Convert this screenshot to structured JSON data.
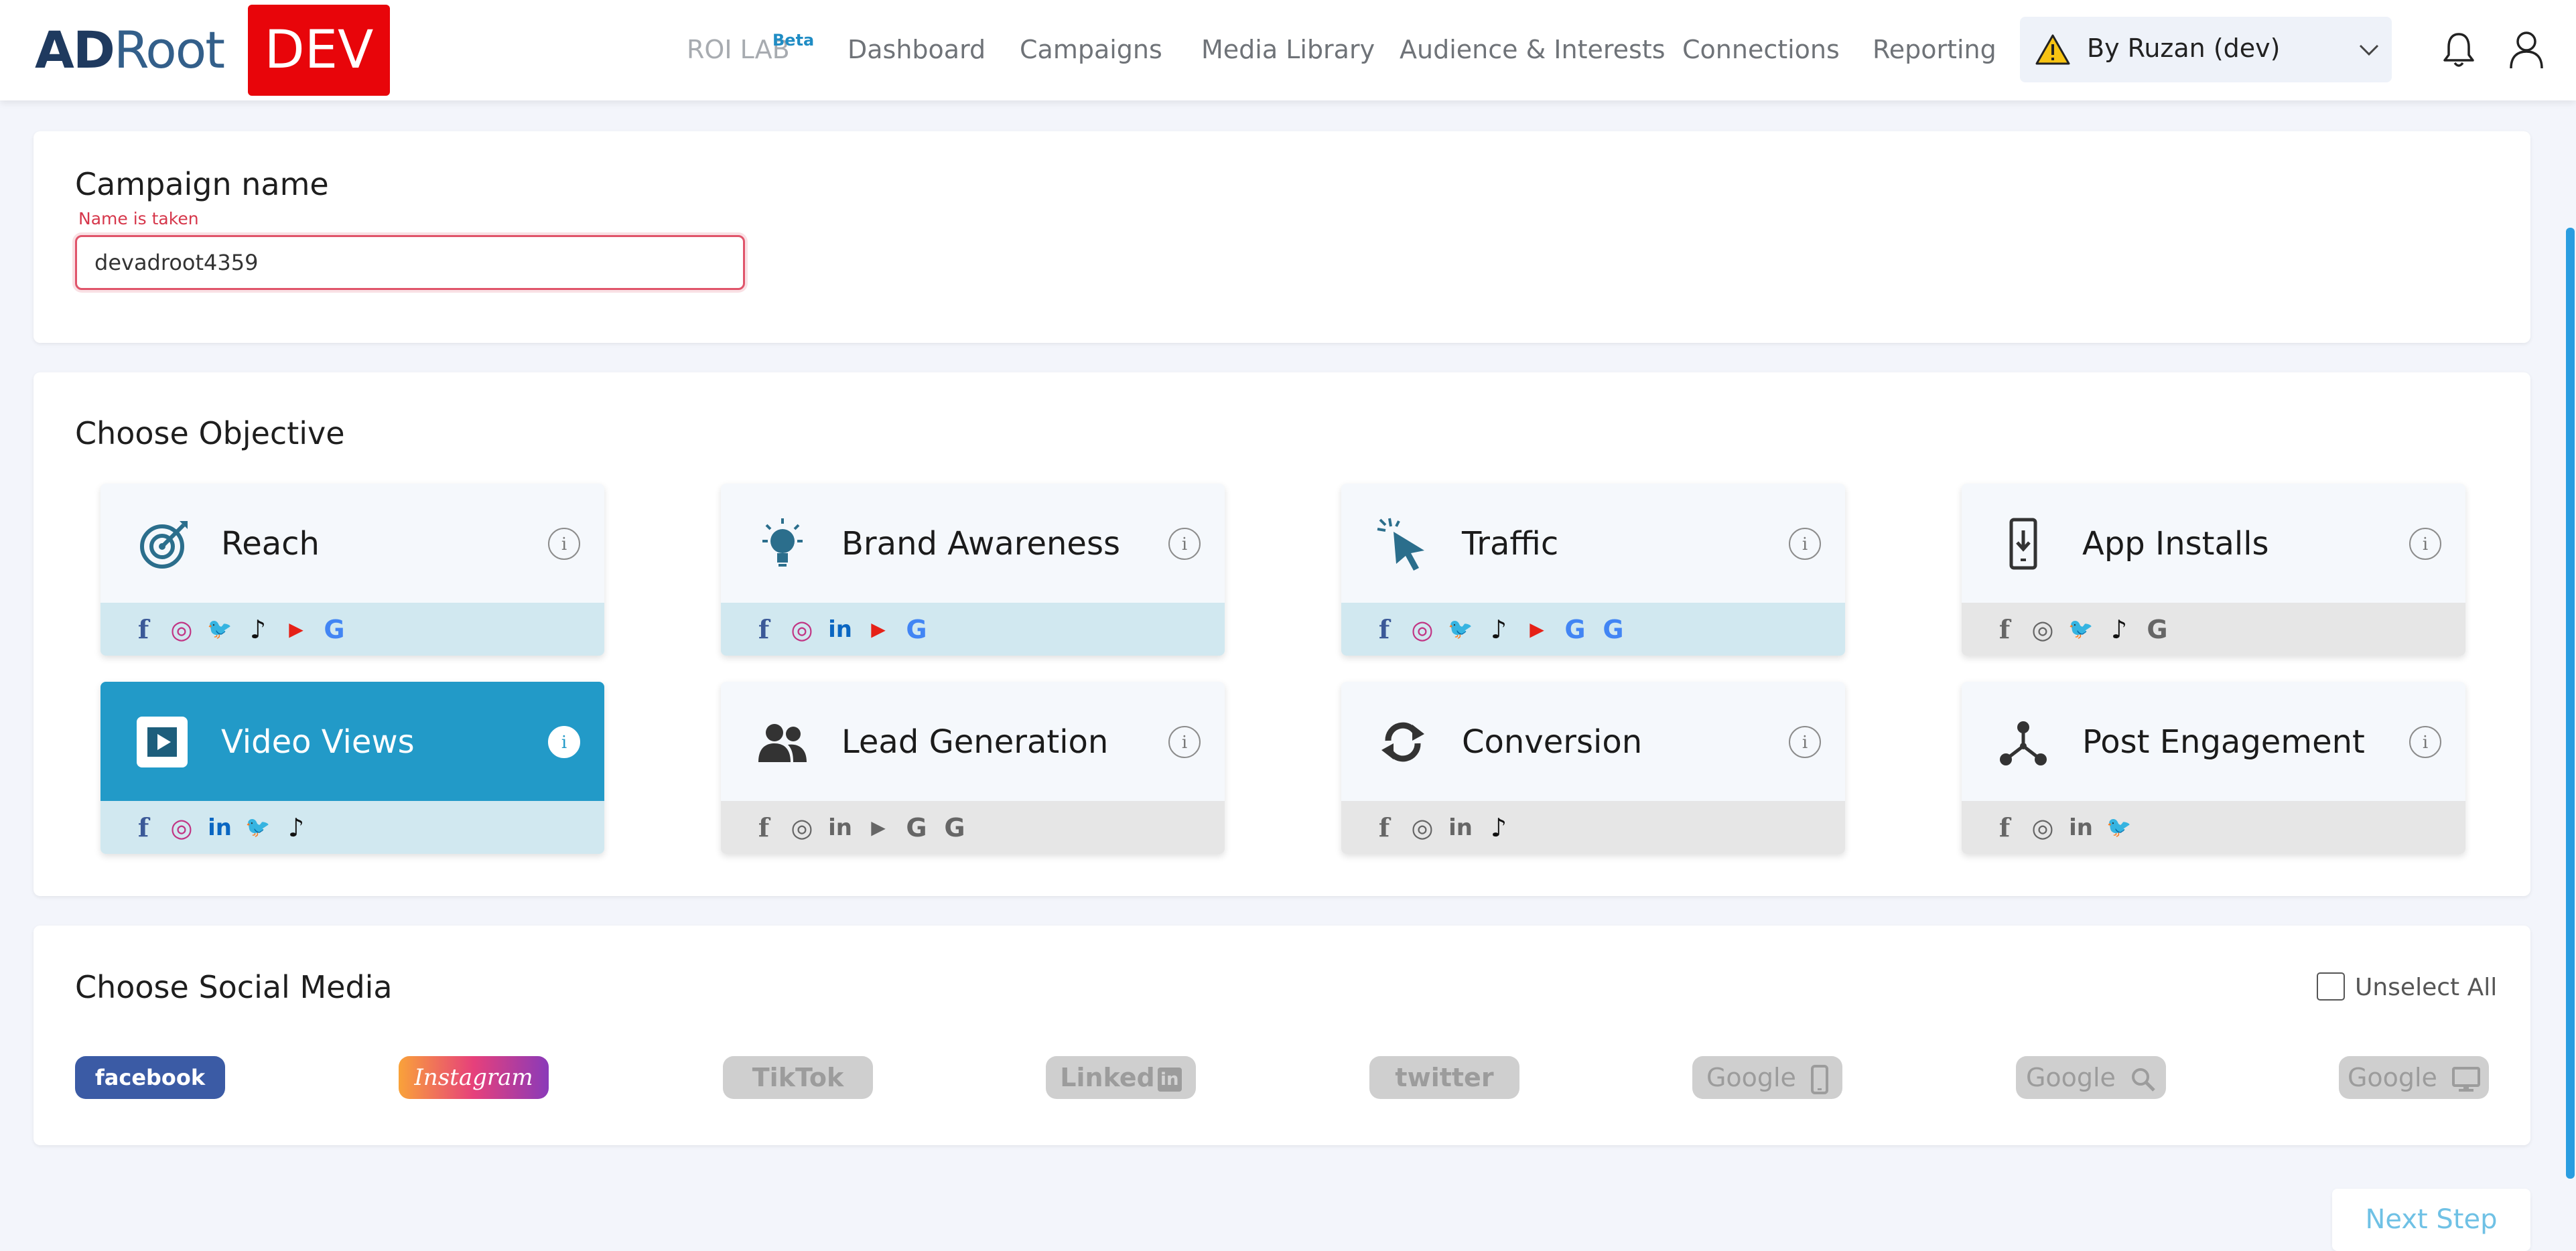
{
  "header": {
    "logo_ad": "AD",
    "logo_root": "Root",
    "env_badge": "DEV",
    "nav": {
      "roi_lab": "ROI LAB",
      "beta": "Beta",
      "dashboard": "Dashboard",
      "campaigns": "Campaigns",
      "media_library": "Media Library",
      "audience": "Audience & Interests",
      "connections": "Connections",
      "reporting": "Reporting"
    },
    "account_label": "By Ruzan (dev)"
  },
  "campaign": {
    "title": "Campaign name",
    "error": "Name is taken",
    "value": "devadroot4359"
  },
  "objective": {
    "title": "Choose Objective",
    "info": "i",
    "tiles": [
      {
        "label": "Reach",
        "icon": "target-icon",
        "state": "active",
        "socials": [
          "facebook",
          "instagram",
          "twitter",
          "tiktok",
          "youtube",
          "google"
        ]
      },
      {
        "label": "Brand Awareness",
        "icon": "lightbulb-icon",
        "state": "active",
        "socials": [
          "facebook",
          "instagram",
          "linkedin",
          "youtube",
          "google"
        ]
      },
      {
        "label": "Traffic",
        "icon": "cursor-click-icon",
        "state": "active",
        "socials": [
          "facebook",
          "instagram",
          "twitter",
          "tiktok",
          "youtube",
          "google",
          "google"
        ]
      },
      {
        "label": "App Installs",
        "icon": "phone-download-icon",
        "state": "disabled",
        "socials": [
          "facebook",
          "instagram",
          "twitter",
          "tiktok",
          "google"
        ]
      },
      {
        "label": "Video Views",
        "icon": "play-icon",
        "state": "selected",
        "socials": [
          "facebook",
          "instagram",
          "linkedin",
          "twitter",
          "tiktok"
        ]
      },
      {
        "label": "Lead Generation",
        "icon": "users-icon",
        "state": "disabled",
        "socials": [
          "facebook",
          "instagram",
          "linkedin",
          "youtube",
          "google",
          "google"
        ]
      },
      {
        "label": "Conversion",
        "icon": "sync-icon",
        "state": "disabled",
        "socials": [
          "facebook",
          "instagram",
          "linkedin",
          "tiktok"
        ]
      },
      {
        "label": "Post Engagement",
        "icon": "share-nodes-icon",
        "state": "disabled",
        "socials": [
          "facebook",
          "instagram",
          "linkedin",
          "twitter"
        ]
      }
    ]
  },
  "social_media": {
    "title": "Choose Social Media",
    "unselect_all": "Unselect All",
    "chips": [
      {
        "label": "facebook",
        "state": "selected"
      },
      {
        "label": "Instagram",
        "state": "selected"
      },
      {
        "label": "TikTok",
        "state": "off"
      },
      {
        "label": "Linked",
        "state": "off"
      },
      {
        "label": "twitter",
        "state": "off"
      },
      {
        "label": "Google",
        "state": "off"
      },
      {
        "label": "Google",
        "state": "off"
      },
      {
        "label": "Google",
        "state": "off"
      }
    ]
  },
  "next_step": "Next Step",
  "colors": {
    "accent": "#229ac8",
    "dev_badge": "#e8050a",
    "error": "#d6374b",
    "facebook": "#3b5998",
    "instagram": "#c13584",
    "twitter": "#1da1f2",
    "youtube": "#e62117",
    "linkedin": "#0a66c2",
    "tiktok": "#111111"
  }
}
